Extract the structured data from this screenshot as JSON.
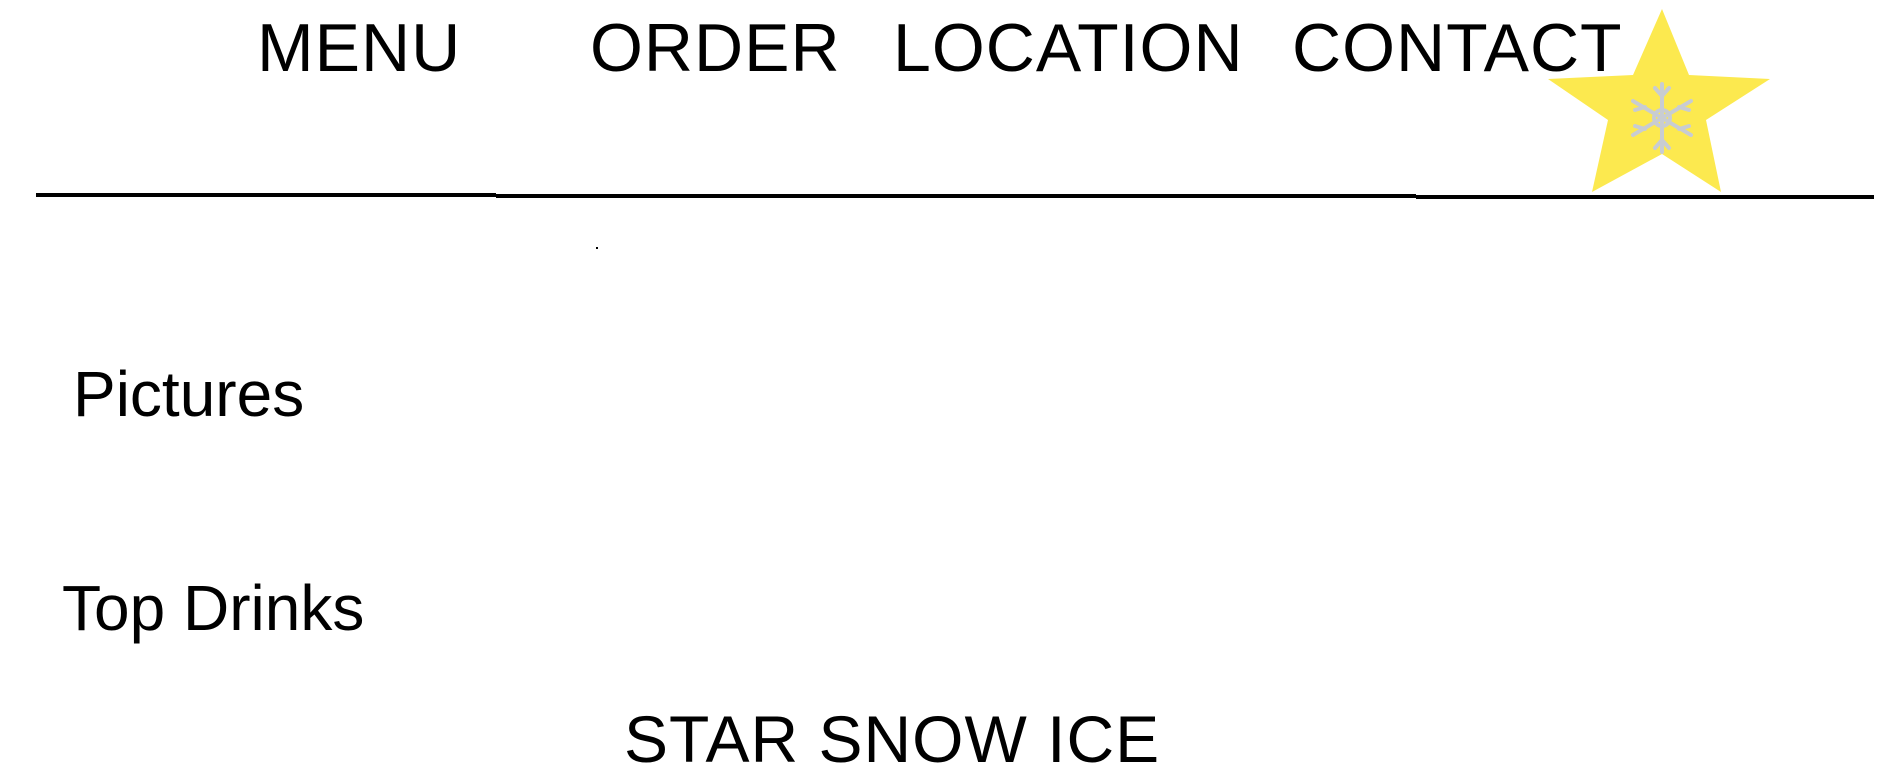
{
  "nav": {
    "items": [
      {
        "label": "MENU"
      },
      {
        "label": "ORDER"
      },
      {
        "label": "LOCATION"
      },
      {
        "label": "CONTACT"
      }
    ]
  },
  "logo": {
    "icon": "star-snowflake-logo",
    "star_color": "#FCE94F",
    "snowflake_color": "#C8CCD2"
  },
  "sections": {
    "pictures_label": "Pictures",
    "top_drinks_label": "Top Drinks"
  },
  "brand": {
    "name": "STAR SNOW ICE"
  }
}
